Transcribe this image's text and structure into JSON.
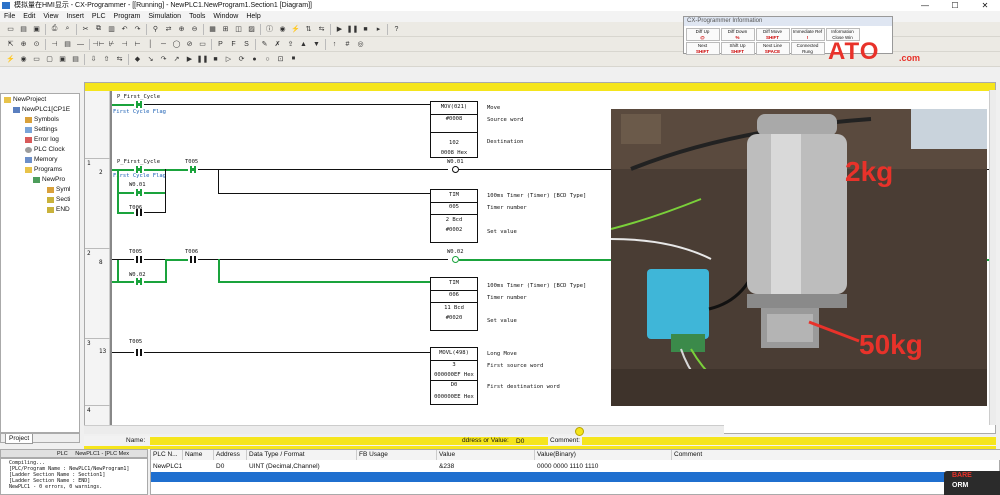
{
  "window": {
    "title": "模拟量在HMI显示 - CX-Programmer - [[Running] - NewPLC1.NewProgram1.Section1 [Diagram]]",
    "minimize": "—",
    "maximize": "☐",
    "close": "✕"
  },
  "menu": [
    "File",
    "Edit",
    "View",
    "Insert",
    "PLC",
    "Program",
    "Simulation",
    "Tools",
    "Window",
    "Help"
  ],
  "info_panel": {
    "title": "CX-Programmer Information",
    "keys": [
      {
        "name": "Diff Up",
        "key": "@"
      },
      {
        "name": "Diff Down",
        "key": "%"
      },
      {
        "name": "Diff Move",
        "key": "SHIFT"
      },
      {
        "name": "Immediate Ref",
        "key": "!"
      },
      {
        "name": "Information Close Win",
        "key": "Alt+I"
      },
      {
        "name": "Next",
        "key": "SHIFT"
      },
      {
        "name": "Shift Up",
        "key": "SHIFT"
      },
      {
        "name": "Next Line",
        "key": "SPACE"
      },
      {
        "name": "Connected Rung",
        "key": "SHIFT"
      }
    ]
  },
  "brand": {
    "logo": "ATO",
    "suffix": ".com",
    "color": "#e8322a"
  },
  "tree": {
    "items": [
      {
        "label": "NewProject",
        "icon": "folder-icon"
      },
      {
        "label": "NewPLC1[CP1E",
        "icon": "plc-icon"
      },
      {
        "label": "Symbols",
        "icon": "symbols-icon"
      },
      {
        "label": "Settings",
        "icon": "settings-icon"
      },
      {
        "label": "Error log",
        "icon": "error-log-icon"
      },
      {
        "label": "PLC Clock",
        "icon": "clock-icon"
      },
      {
        "label": "Memory",
        "icon": "memory-icon"
      },
      {
        "label": "Programs",
        "icon": "programs-icon"
      },
      {
        "label": "NewPro",
        "icon": "program-icon"
      },
      {
        "label": "Syml",
        "icon": "symbols-icon"
      },
      {
        "label": "Secti",
        "icon": "section-icon"
      },
      {
        "label": "END",
        "icon": "end-icon"
      }
    ],
    "tab": "Project"
  },
  "ladder": {
    "rungs": [
      {
        "rung": "",
        "step": ""
      },
      {
        "rung": "1",
        "step": "2"
      },
      {
        "rung": "2",
        "step": "8"
      },
      {
        "rung": "3",
        "step": "13"
      },
      {
        "rung": "4",
        "step": ""
      }
    ],
    "r0": {
      "contact": "P_First_Cycle",
      "comment": "First Cycle Flag",
      "instr": "MOV(021)",
      "op1": "#0008",
      "op2": "102",
      "op3": "0008 Hex",
      "d1": "Move",
      "d2": "Source word",
      "d3": "Destination"
    },
    "r1": {
      "c1": "P_First_Cycle",
      "c1_comment": "First Cycle Flag",
      "c2": "T005",
      "c3": "W0.01",
      "c4": "T006",
      "coil": "W0.01",
      "instr": "TIM",
      "op1": "005",
      "op2": "2 Bcd",
      "op3": "#0002",
      "d1": "100ms Timer (Timer) [BCD Type]",
      "d2": "Timer number",
      "d3": "Set value"
    },
    "r2": {
      "c1": "T005",
      "c2": "T006",
      "c3": "W0.02",
      "coil": "W0.02",
      "instr": "TIM",
      "op1": "006",
      "op2": "11 Bcd",
      "op3": "#0020",
      "d1": "100ms Timer (Timer) [BCD Type]",
      "d2": "Timer number",
      "d3": "Set value"
    },
    "r3": {
      "c1": "T005",
      "instr": "MOVL(498)",
      "op1": "3",
      "op2": "000000EF Hex",
      "op3": "D0",
      "op4": "000000EE Hex",
      "d1": "Long Move",
      "d2": "First source word",
      "d3": "First destination word"
    }
  },
  "photo": {
    "label1": "2kg",
    "label2": "50kg"
  },
  "name_bar": {
    "name_label": "Name:",
    "address_label": "ddress or Value:",
    "address_value": "D0",
    "comment_label": "Comment:"
  },
  "output": {
    "tab1": "PLC",
    "tab2": "NewPLC1 - [PLC Mex",
    "lines": [
      "Compiling...",
      "[PLC/Program Name : NewPLC1/NewProgram1]",
      "[Ladder Section Name : Section1]",
      "[Ladder Section Name : END]",
      "",
      "NewPLC1 - 0 errors, 0 warnings."
    ]
  },
  "watch": {
    "headers": [
      "PLC N...",
      "Name",
      "Address",
      "Data Type / Format",
      "FB Usage",
      "Value",
      "Value(Binary)",
      "Comment"
    ],
    "row": [
      "NewPLC1",
      "",
      "D0",
      "UINT (Decimal,Channel)",
      "",
      "&238",
      "0000 0000 1110 1110",
      ""
    ]
  },
  "popup": {
    "a": "BARE",
    "b": "ORM"
  }
}
